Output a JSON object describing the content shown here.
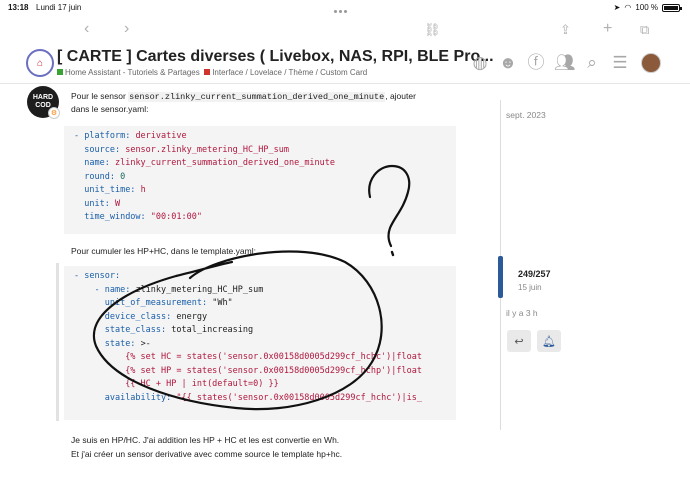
{
  "status_bar": {
    "time": "13:18",
    "date": "Lundi 17 juin",
    "battery": "100 %",
    "battery_level": 1.0
  },
  "toolbar": {
    "back_icon": "chevron-left-icon",
    "forward_icon": "chevron-right-icon",
    "link_icon": "link-icon",
    "share_icon": "share-icon",
    "add_icon": "plus-icon",
    "tabs_icon": "tabs-icon"
  },
  "header": {
    "title": "[ CARTE ] Cartes diverses ( Livebox, NAS, RPI, BLE Pro...",
    "categories": [
      {
        "label": "Home Assistant - Tutoriels & Partages",
        "color": "#3aa335"
      },
      {
        "label": "Interface / Lovelace / Thème / Custom Card",
        "color": "#d0342c"
      }
    ]
  },
  "post": {
    "avatar_text": "HARD COD",
    "intro_prefix": "Pour le sensor ",
    "intro_code": "sensor.zlinky_current_summation_derived_one_minute",
    "intro_suffix": ", ajouter",
    "intro_line2": "dans le sensor.yaml:",
    "code1": [
      {
        "indent": "",
        "dash": "- ",
        "key": "platform",
        "val": "derivative",
        "vclass": "s"
      },
      {
        "indent": "  ",
        "dash": "",
        "key": "source",
        "val": "sensor.zlinky_metering_HC_HP_sum",
        "vclass": "s"
      },
      {
        "indent": "  ",
        "dash": "",
        "key": "name",
        "val": "zlinky_current_summation_derived_one_minute",
        "vclass": "s"
      },
      {
        "indent": "  ",
        "dash": "",
        "key": "round",
        "val": "0",
        "vclass": "n"
      },
      {
        "indent": "  ",
        "dash": "",
        "key": "unit_time",
        "val": "h",
        "vclass": "s"
      },
      {
        "indent": "  ",
        "dash": "",
        "key": "unit",
        "val": "W",
        "vclass": "s"
      },
      {
        "indent": "  ",
        "dash": "",
        "key": "time_window",
        "val": "\"00:01:00\"",
        "vclass": "s"
      }
    ],
    "mid_text": "Pour cumuler les HP+HC, dans le template.yaml:",
    "code2": [
      {
        "indent": "",
        "dash": "- ",
        "key": "sensor",
        "val": "",
        "vclass": "p"
      },
      {
        "indent": "    ",
        "dash": "- ",
        "key": "name",
        "val": "zlinky_metering_HC_HP_sum",
        "vclass": "p"
      },
      {
        "indent": "      ",
        "dash": "",
        "key": "unit_of_measurement",
        "val": "\"Wh\"",
        "vclass": "p"
      },
      {
        "indent": "      ",
        "dash": "",
        "key": "device_class",
        "val": "energy",
        "vclass": "p"
      },
      {
        "indent": "      ",
        "dash": "",
        "key": "state_class",
        "val": "total_increasing",
        "vclass": "p"
      },
      {
        "indent": "      ",
        "dash": "",
        "key": "state",
        "val": ">-",
        "vclass": "p"
      },
      {
        "indent": "          ",
        "dash": "",
        "key": "",
        "val": "{% set HC = states('sensor.0x00158d0005d299cf_hchc')|float",
        "vclass": "s"
      },
      {
        "indent": "          ",
        "dash": "",
        "key": "",
        "val": "{% set HP = states('sensor.0x00158d0005d299cf_hchp')|float",
        "vclass": "s"
      },
      {
        "indent": "          ",
        "dash": "",
        "key": "",
        "val": "{{ HC + HP | int(default=0) }}",
        "vclass": "s"
      },
      {
        "indent": "      ",
        "dash": "",
        "key": "availability",
        "val": "\"{{ states('sensor.0x00158d0005d299cf_hchc')|is_",
        "vclass": "s"
      }
    ],
    "outro_line1": "Je suis en HP/HC. J'ai addition les HP + HC et les est convertie en Wh.",
    "outro_line2": "Et j'ai créer un sensor derivative avec comme source le template hp+hc."
  },
  "timeline": {
    "start_date": "sept. 2023",
    "count": "249/257",
    "count_date": "15 juin",
    "ago": "il y a 3 h",
    "reply_icon": "reply-icon",
    "notify_icon": "bell-icon"
  }
}
